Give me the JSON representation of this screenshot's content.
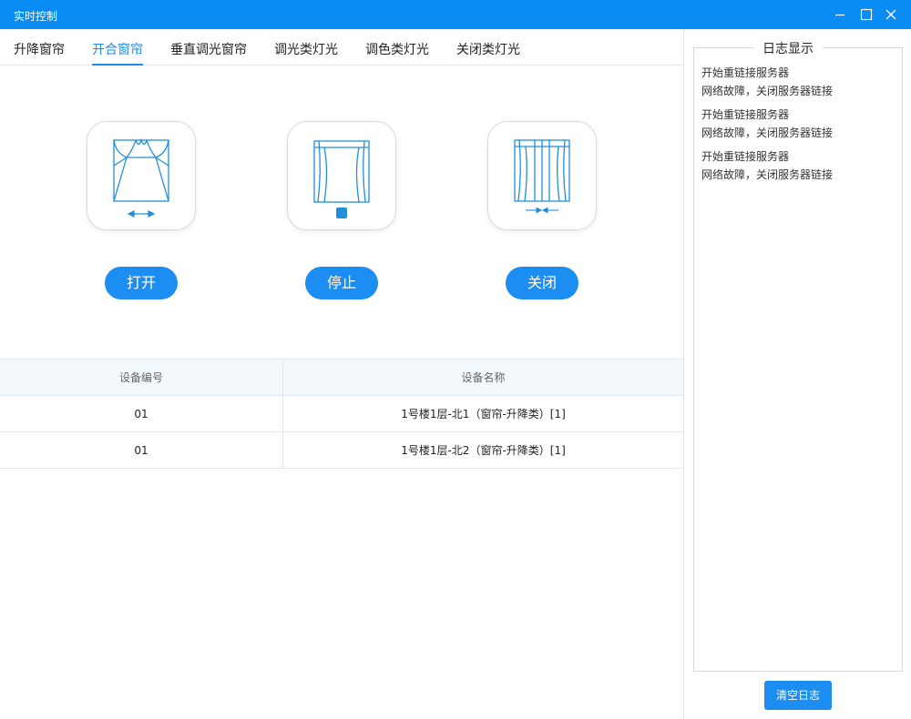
{
  "window": {
    "title": "实时控制"
  },
  "tabs": [
    {
      "label": "升降窗帘",
      "active": false
    },
    {
      "label": "开合窗帘",
      "active": true
    },
    {
      "label": "垂直调光窗帘",
      "active": false
    },
    {
      "label": "调光类灯光",
      "active": false
    },
    {
      "label": "调色类灯光",
      "active": false
    },
    {
      "label": "关闭类灯光",
      "active": false
    }
  ],
  "controls": [
    {
      "icon": "curtain-open-icon",
      "button_label": "打开"
    },
    {
      "icon": "curtain-stop-icon",
      "button_label": "停止"
    },
    {
      "icon": "curtain-close-icon",
      "button_label": "关闭"
    }
  ],
  "table": {
    "headers": [
      "设备编号",
      "设备名称"
    ],
    "rows": [
      [
        "01",
        "1号楼1层-北1（窗帘-升降类）[1]"
      ],
      [
        "01",
        "1号楼1层-北2（窗帘-升降类）[1]"
      ]
    ]
  },
  "log": {
    "title": "日志显示",
    "lines": [
      "开始重链接服务器",
      "网络故障，关闭服务器链接",
      "开始重链接服务器",
      "网络故障，关闭服务器链接",
      "开始重链接服务器",
      "网络故障，关闭服务器链接"
    ],
    "clear_label": "清空日志"
  },
  "colors": {
    "accent": "#1a8cef",
    "titlebar": "#0a8cf5",
    "icon": "#1f8fd8"
  }
}
